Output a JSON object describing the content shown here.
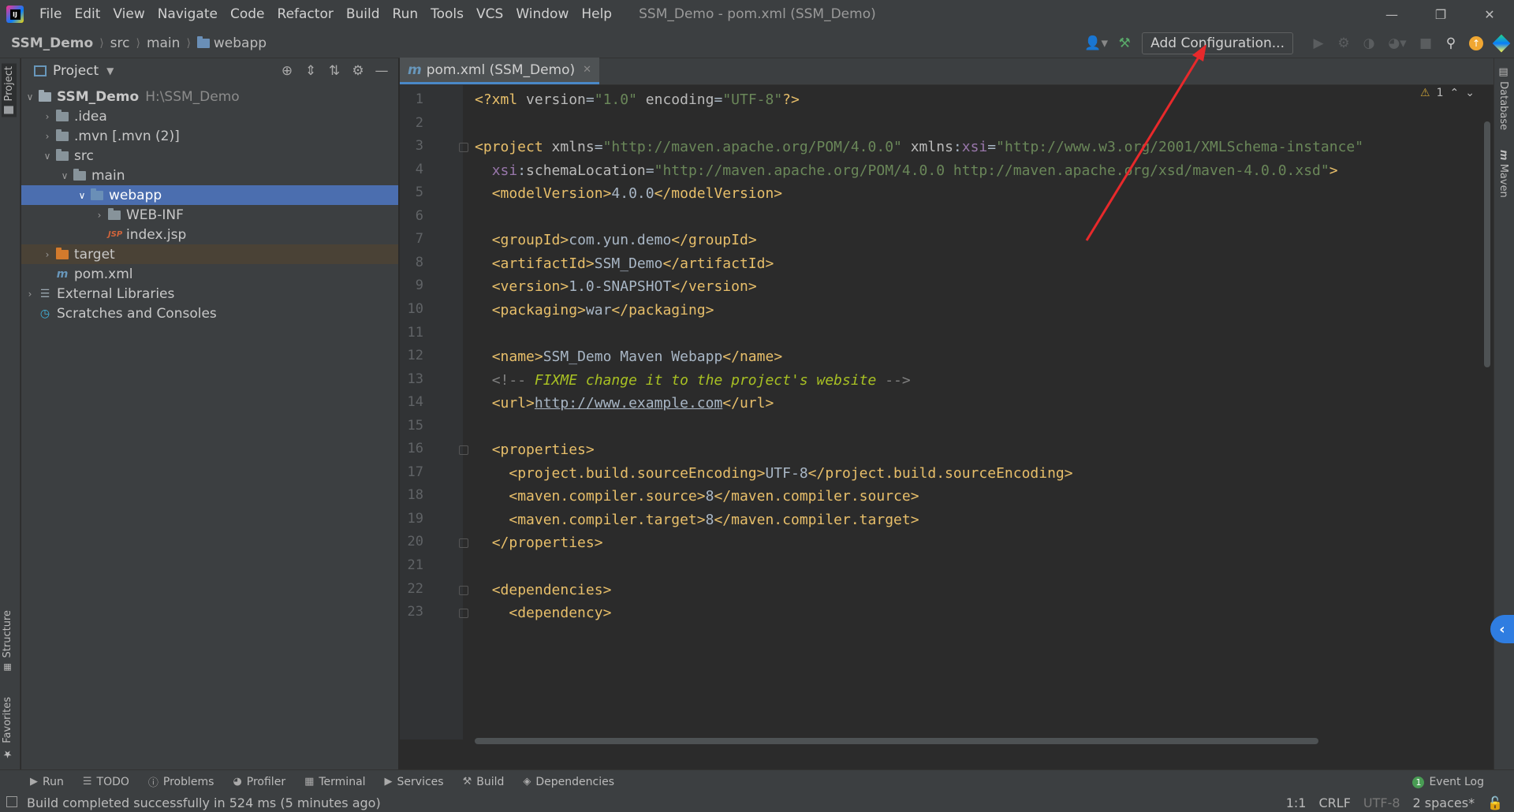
{
  "titlebar": {
    "menu": [
      "File",
      "Edit",
      "View",
      "Navigate",
      "Code",
      "Refactor",
      "Build",
      "Run",
      "Tools",
      "VCS",
      "Window",
      "Help"
    ],
    "window_title": "SSM_Demo - pom.xml (SSM_Demo)"
  },
  "navbar": {
    "breadcrumbs": [
      "SSM_Demo",
      "src",
      "main",
      "webapp"
    ],
    "add_configuration": "Add Configuration..."
  },
  "project_panel": {
    "title": "Project",
    "tree": [
      {
        "label": "SSM_Demo",
        "path": "H:\\SSM_Demo",
        "bold": true
      },
      {
        "label": ".idea"
      },
      {
        "label": ".mvn [.mvn (2)]"
      },
      {
        "label": "src"
      },
      {
        "label": "main"
      },
      {
        "label": "webapp"
      },
      {
        "label": "WEB-INF"
      },
      {
        "label": "index.jsp"
      },
      {
        "label": "target"
      },
      {
        "label": "pom.xml"
      },
      {
        "label": "External Libraries"
      },
      {
        "label": "Scratches and Consoles"
      }
    ]
  },
  "left_stripe": {
    "project": "Project",
    "structure": "Structure",
    "favorites": "Favorites"
  },
  "right_stripe": {
    "database": "Database",
    "maven": "Maven"
  },
  "editor": {
    "tab_label": "pom.xml (SSM_Demo)",
    "warning_count": "1",
    "line_numbers": [
      "1",
      "2",
      "3",
      "4",
      "5",
      "6",
      "7",
      "8",
      "9",
      "10",
      "11",
      "12",
      "13",
      "14",
      "15",
      "16",
      "17",
      "18",
      "19",
      "20",
      "21",
      "22",
      "23"
    ]
  },
  "bottom_tools": [
    "Run",
    "TODO",
    "Problems",
    "Profiler",
    "Terminal",
    "Services",
    "Build",
    "Dependencies"
  ],
  "event_log": {
    "label": "Event Log",
    "count": "1"
  },
  "status": {
    "message": "Build completed successfully in 524 ms (5 minutes ago)",
    "position": "1:1",
    "line_sep": "CRLF",
    "encoding": "UTF-8",
    "indent": "2 spaces*"
  },
  "colors": {
    "accent": "#4b6eaf",
    "annotation": "#e8292b",
    "tag": "#e8bf6a",
    "attr_value": "#6a8759"
  }
}
